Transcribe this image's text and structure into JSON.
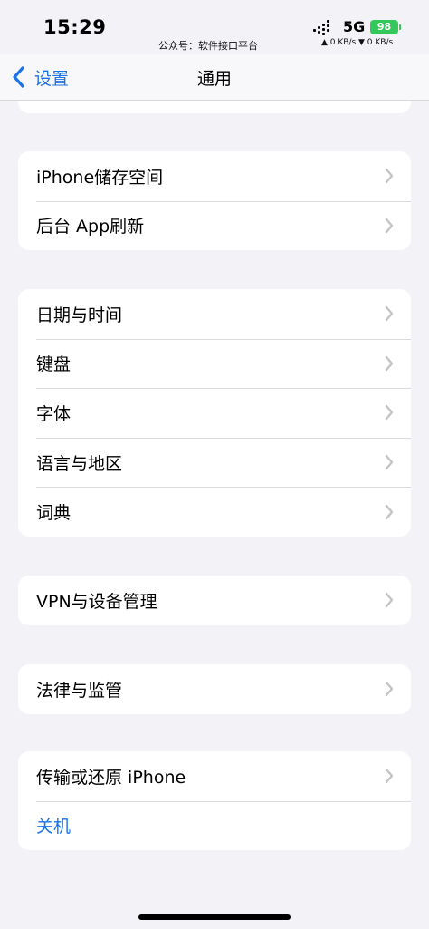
{
  "status_bar": {
    "time": "15:29",
    "watermark": "公众号：软件接口平台",
    "network_type": "5G",
    "battery": "98",
    "net_speed": "▲ 0 KB/s ▼ 0 KB/s"
  },
  "nav": {
    "back_label": "设置",
    "title": "通用",
    "accent_color": "#1a73e8"
  },
  "groups": [
    {
      "items": [
        {
          "label": "iPhone储存空间"
        },
        {
          "label": "后台 App刷新"
        }
      ]
    },
    {
      "items": [
        {
          "label": "日期与时间"
        },
        {
          "label": "键盘"
        },
        {
          "label": "字体"
        },
        {
          "label": "语言与地区"
        },
        {
          "label": "词典"
        }
      ]
    },
    {
      "items": [
        {
          "label": "VPN与设备管理"
        }
      ]
    },
    {
      "items": [
        {
          "label": "法律与监管"
        }
      ]
    },
    {
      "items": [
        {
          "label": "传输或还原 iPhone"
        },
        {
          "label": "关机"
        }
      ]
    }
  ],
  "icons": [
    "back-chevron-icon",
    "chevron-right-icon",
    "signal-icon",
    "battery-icon"
  ]
}
